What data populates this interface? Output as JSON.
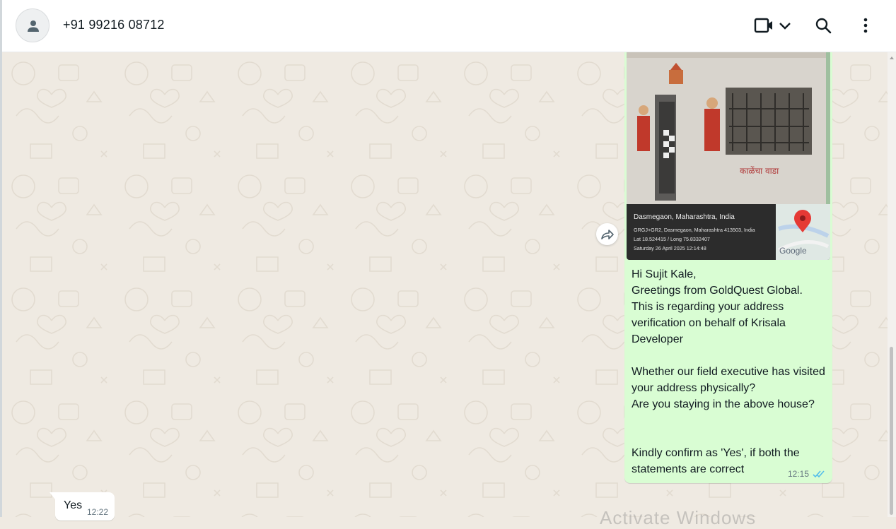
{
  "header": {
    "contact_name": "+91 99216 08712",
    "icons": [
      "default-avatar-icon",
      "video-call-icon",
      "chevron-down-icon",
      "search-icon",
      "more-options-icon"
    ]
  },
  "messages": {
    "outgoing": {
      "location": {
        "place": "Dasmegaon, Maharashtra, India",
        "address": "GRGJ+GR2, Dasmegaon, Maharashtra 413503, India",
        "coords": "Lat 18.524415 / Long 75.8332407",
        "datetime": "Saturday 26 April 2025 12:14:48",
        "map_brand": "Google",
        "marathi_sign": "काळेंचा वाडा"
      },
      "text": "Hi Sujit Kale,\nGreetings from GoldQuest Global.\nThis is regarding your address verification on behalf of Krisala Developer\n\nWhether our field executive has visited your address physically?\nAre you staying in the above house?\n\n\nKindly confirm as 'Yes', if both the statements are correct",
      "time": "12:15",
      "status": "read"
    },
    "incoming": {
      "text": "Yes",
      "time": "12:22"
    }
  },
  "watermark": "Activate Windows",
  "colors": {
    "outgoing_bubble": "#d9fdd3",
    "incoming_bubble": "#ffffff",
    "chat_background": "#efeae2",
    "read_ticks": "#53bdeb"
  }
}
